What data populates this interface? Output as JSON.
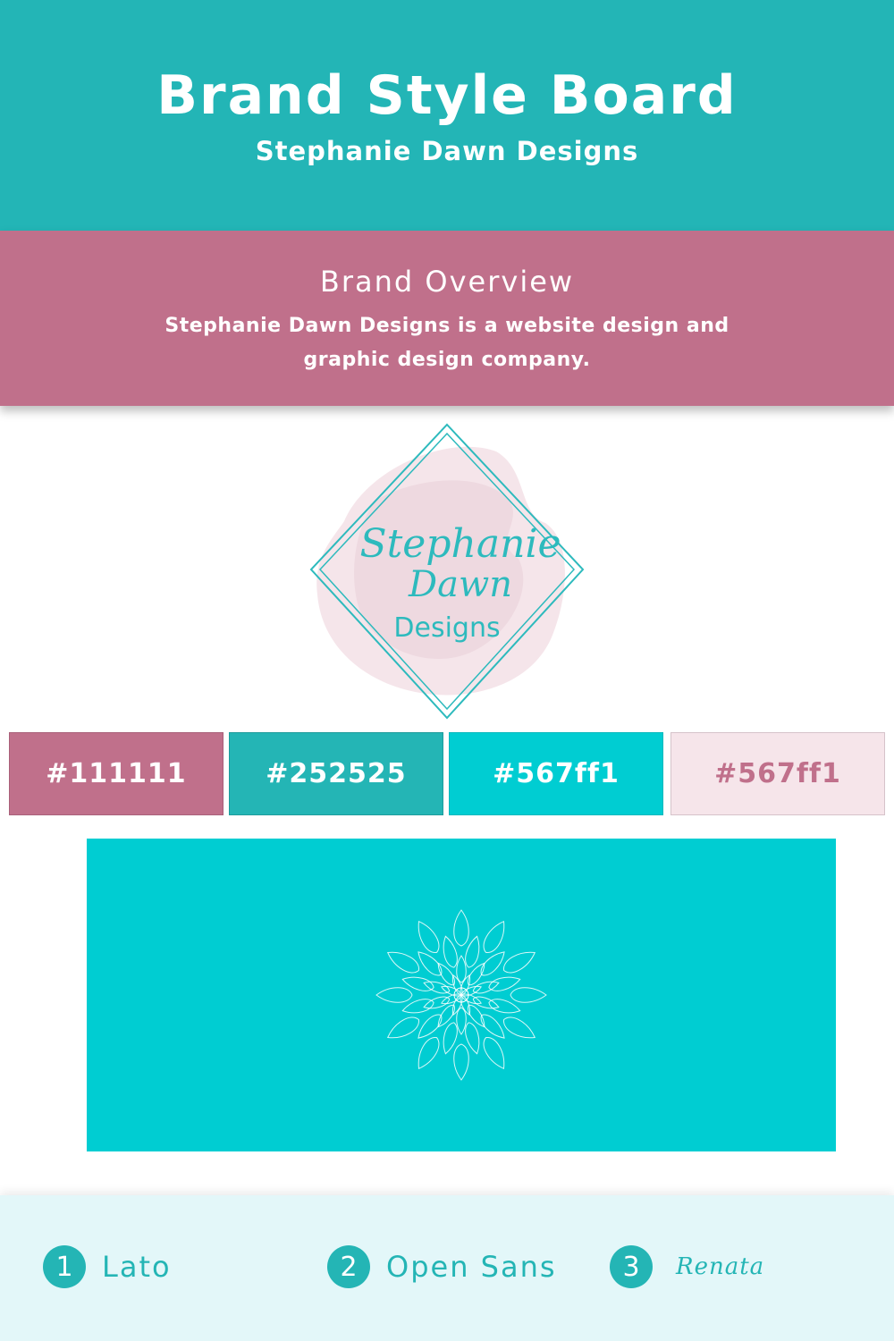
{
  "header": {
    "title": "Brand Style Board",
    "subtitle": "Stephanie Dawn Designs"
  },
  "overview": {
    "heading": "Brand Overview",
    "description": "Stephanie Dawn Designs is a website design and graphic design company."
  },
  "logo": {
    "line1": "Stephanie",
    "line2": "Dawn",
    "line3": "Designs"
  },
  "swatches": [
    {
      "label": "#111111",
      "color": "#c0708b"
    },
    {
      "label": "#252525",
      "color": "#24b5b5"
    },
    {
      "label": "#567ff1",
      "color": "#00cdd2"
    },
    {
      "label": "#567ff1",
      "color": "#f6e5ea"
    }
  ],
  "pattern": {
    "background": "#00cdd2",
    "icon": "mandala-icon"
  },
  "fonts": [
    {
      "number": "1",
      "name": "Lato"
    },
    {
      "number": "2",
      "name": "Open Sans"
    },
    {
      "number": "3",
      "name": "Renata"
    }
  ]
}
